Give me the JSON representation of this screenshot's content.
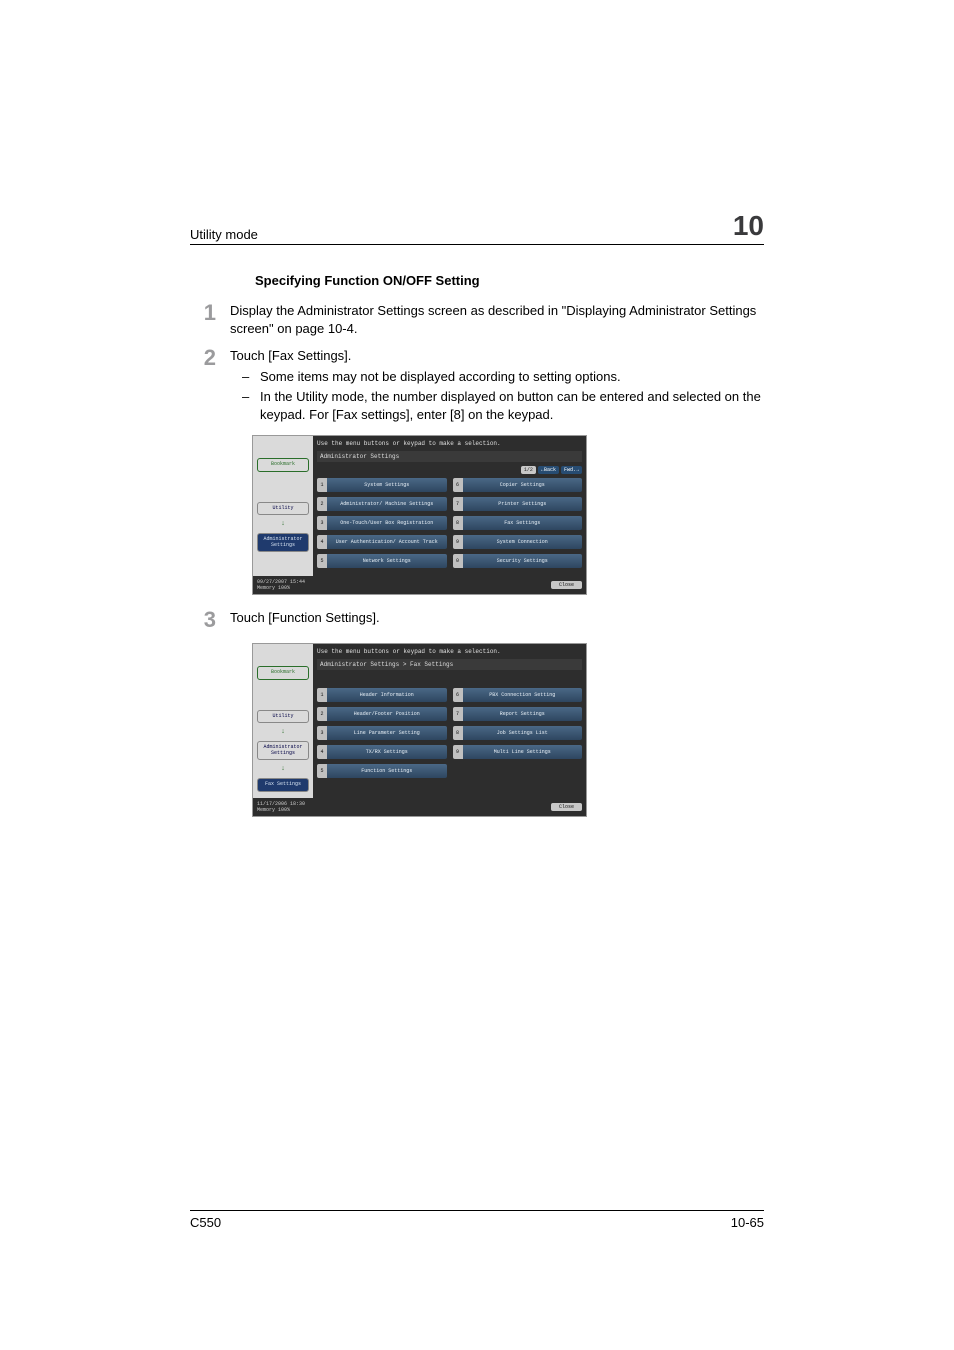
{
  "header": {
    "left": "Utility mode",
    "chapter": "10"
  },
  "section_title": "Specifying Function ON/OFF Setting",
  "steps": [
    {
      "num": "1",
      "text": "Display the Administrator Settings screen as described in \"Displaying Administrator Settings screen\" on page 10-4.",
      "subs": []
    },
    {
      "num": "2",
      "text": "Touch [Fax Settings].",
      "subs": [
        "Some items may not be displayed according to setting options.",
        "In the Utility mode, the number displayed on button can be entered and selected on the keypad. For [Fax settings], enter [8] on the keypad."
      ]
    },
    {
      "num": "3",
      "text": "Touch [Function Settings].",
      "subs": []
    }
  ],
  "panel1": {
    "instr": "Use the menu buttons or keypad to make a selection.",
    "crumb": "Administrator Settings",
    "pager_page": "1/2",
    "pager_back": "Back",
    "pager_fwd": "Fwd.",
    "side": {
      "bookmark": "Bookmark",
      "utility": "Utility",
      "admin": "Administrator\nSettings"
    },
    "items": [
      {
        "n": "1",
        "label": "System Settings"
      },
      {
        "n": "6",
        "label": "Copier Settings"
      },
      {
        "n": "2",
        "label": "Administrator/ Machine Settings"
      },
      {
        "n": "7",
        "label": "Printer Settings"
      },
      {
        "n": "3",
        "label": "One-Touch/User Box Registration"
      },
      {
        "n": "8",
        "label": "Fax Settings"
      },
      {
        "n": "4",
        "label": "User Authentication/ Account Track"
      },
      {
        "n": "9",
        "label": "System Connection"
      },
      {
        "n": "5",
        "label": "Network Settings"
      },
      {
        "n": "0",
        "label": "Security Settings"
      }
    ],
    "footer_left": "09/27/2007  15:44\nMemory      100%",
    "close": "Close"
  },
  "panel2": {
    "instr": "Use the menu buttons or keypad to make a selection.",
    "crumb": "Administrator Settings  > Fax Settings",
    "side": {
      "bookmark": "Bookmark",
      "utility": "Utility",
      "admin": "Administrator\nSettings",
      "fax": "Fax Settings"
    },
    "items": [
      {
        "n": "1",
        "label": "Header Information"
      },
      {
        "n": "6",
        "label": "PBX Connection Setting"
      },
      {
        "n": "2",
        "label": "Header/Footer Position"
      },
      {
        "n": "7",
        "label": "Report Settings"
      },
      {
        "n": "3",
        "label": "Line Parameter Setting"
      },
      {
        "n": "8",
        "label": "Job Settings List"
      },
      {
        "n": "4",
        "label": "TX/RX Settings"
      },
      {
        "n": "9",
        "label": "Multi Line Settings"
      },
      {
        "n": "5",
        "label": "Function Settings"
      }
    ],
    "footer_left": "11/17/2006  18:30\nMemory      100%",
    "close": "Close"
  },
  "footer": {
    "left": "C550",
    "right": "10-65"
  }
}
